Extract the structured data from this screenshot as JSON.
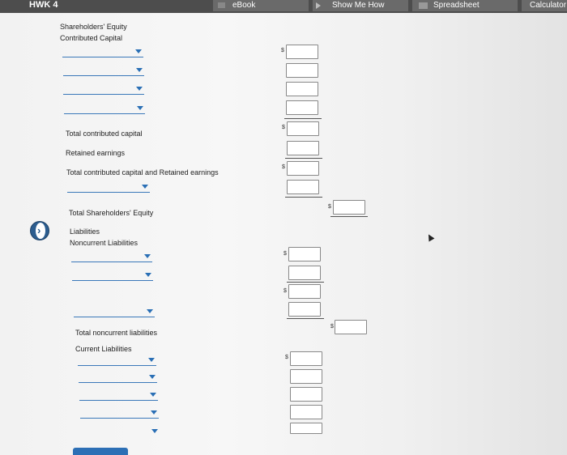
{
  "topbar": {
    "title": "HWK 4",
    "tabs": [
      "eBook",
      "Show Me How",
      "Spreadsheet",
      "Calculator"
    ]
  },
  "labels": {
    "shareholders_equity": "Shareholders' Equity",
    "contributed_capital": "Contributed Capital",
    "total_contributed_capital": "Total contributed capital",
    "retained_earnings": "Retained earnings",
    "total_cc_and_re": "Total contributed capital and Retained earnings",
    "total_shareholders_equity": "Total Shareholders' Equity",
    "liabilities": "Liabilities",
    "noncurrent_liabilities": "Noncurrent Liabilities",
    "total_noncurrent_liabilities": "Total noncurrent liabilities",
    "current_liabilities": "Current Liabilities"
  },
  "currency_symbol": "$",
  "colors": {
    "accent": "#2c6fb5",
    "topbar": "#4d4d4d"
  }
}
